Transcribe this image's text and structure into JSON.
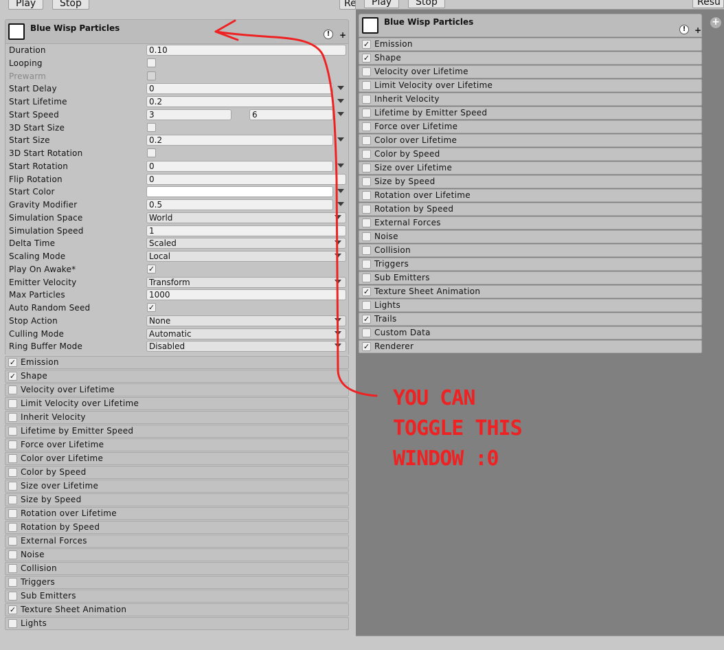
{
  "toolbar": {
    "play_label": "Play",
    "stop_label": "Stop",
    "reset_label": "Re",
    "reset_label_right": "Resu"
  },
  "component": {
    "title": "Blue Wisp Particles",
    "help_symbol": "!",
    "add_symbol": "+"
  },
  "properties": [
    {
      "label": "Duration",
      "type": "field",
      "value": "0.10"
    },
    {
      "label": "Looping",
      "type": "checkbox",
      "checked": false
    },
    {
      "label": "Prewarm",
      "type": "checkbox",
      "checked": false,
      "disabled": true
    },
    {
      "label": "Start Delay",
      "type": "field-dd",
      "value": "0"
    },
    {
      "label": "Start Lifetime",
      "type": "field-dd",
      "value": "0.2"
    },
    {
      "label": "Start Speed",
      "type": "range-dd",
      "value": "3",
      "value2": "6"
    },
    {
      "label": "3D Start Size",
      "type": "checkbox",
      "checked": false
    },
    {
      "label": "Start Size",
      "type": "field-dd",
      "value": "0.2"
    },
    {
      "label": "3D Start Rotation",
      "type": "checkbox",
      "checked": false
    },
    {
      "label": "Start Rotation",
      "type": "field-dd",
      "value": "0"
    },
    {
      "label": "Flip Rotation",
      "type": "field",
      "value": "0"
    },
    {
      "label": "Start Color",
      "type": "color-dd",
      "value": "#ffffff"
    },
    {
      "label": "Gravity Modifier",
      "type": "field-dd",
      "value": "0.5"
    },
    {
      "label": "Simulation Space",
      "type": "dropdown",
      "value": "World"
    },
    {
      "label": "Simulation Speed",
      "type": "field",
      "value": "1"
    },
    {
      "label": "Delta Time",
      "type": "dropdown",
      "value": "Scaled"
    },
    {
      "label": "Scaling Mode",
      "type": "dropdown",
      "value": "Local"
    },
    {
      "label": "Play On Awake*",
      "type": "checkbox",
      "checked": true
    },
    {
      "label": "Emitter Velocity",
      "type": "dropdown",
      "value": "Transform"
    },
    {
      "label": "Max Particles",
      "type": "field",
      "value": "1000"
    },
    {
      "label": "Auto Random Seed",
      "type": "checkbox",
      "checked": true
    },
    {
      "label": "Stop Action",
      "type": "dropdown",
      "value": "None"
    },
    {
      "label": "Culling Mode",
      "type": "dropdown",
      "value": "Automatic"
    },
    {
      "label": "Ring Buffer Mode",
      "type": "dropdown",
      "value": "Disabled"
    }
  ],
  "modules_left": [
    {
      "label": "Emission",
      "checked": true
    },
    {
      "label": "Shape",
      "checked": true
    },
    {
      "label": "Velocity over Lifetime",
      "checked": false
    },
    {
      "label": "Limit Velocity over Lifetime",
      "checked": false
    },
    {
      "label": "Inherit Velocity",
      "checked": false
    },
    {
      "label": "Lifetime by Emitter Speed",
      "checked": false
    },
    {
      "label": "Force over Lifetime",
      "checked": false
    },
    {
      "label": "Color over Lifetime",
      "checked": false
    },
    {
      "label": "Color by Speed",
      "checked": false
    },
    {
      "label": "Size over Lifetime",
      "checked": false
    },
    {
      "label": "Size by Speed",
      "checked": false
    },
    {
      "label": "Rotation over Lifetime",
      "checked": false
    },
    {
      "label": "Rotation by Speed",
      "checked": false
    },
    {
      "label": "External Forces",
      "checked": false
    },
    {
      "label": "Noise",
      "checked": false
    },
    {
      "label": "Collision",
      "checked": false
    },
    {
      "label": "Triggers",
      "checked": false
    },
    {
      "label": "Sub Emitters",
      "checked": false
    },
    {
      "label": "Texture Sheet Animation",
      "checked": true
    },
    {
      "label": "Lights",
      "checked": false
    }
  ],
  "modules_right": [
    {
      "label": "Emission",
      "checked": true
    },
    {
      "label": "Shape",
      "checked": true
    },
    {
      "label": "Velocity over Lifetime",
      "checked": false
    },
    {
      "label": "Limit Velocity over Lifetime",
      "checked": false
    },
    {
      "label": "Inherit Velocity",
      "checked": false
    },
    {
      "label": "Lifetime by Emitter Speed",
      "checked": false
    },
    {
      "label": "Force over Lifetime",
      "checked": false
    },
    {
      "label": "Color over Lifetime",
      "checked": false
    },
    {
      "label": "Color by Speed",
      "checked": false
    },
    {
      "label": "Size over Lifetime",
      "checked": false
    },
    {
      "label": "Size by Speed",
      "checked": false
    },
    {
      "label": "Rotation over Lifetime",
      "checked": false
    },
    {
      "label": "Rotation by Speed",
      "checked": false
    },
    {
      "label": "External Forces",
      "checked": false
    },
    {
      "label": "Noise",
      "checked": false
    },
    {
      "label": "Collision",
      "checked": false
    },
    {
      "label": "Triggers",
      "checked": false
    },
    {
      "label": "Sub Emitters",
      "checked": false
    },
    {
      "label": "Texture Sheet Animation",
      "checked": true
    },
    {
      "label": "Lights",
      "checked": false
    },
    {
      "label": "Trails",
      "checked": true
    },
    {
      "label": "Custom Data",
      "checked": false
    },
    {
      "label": "Renderer",
      "checked": true
    }
  ],
  "annotation": {
    "lines": [
      "YOU CAN",
      "TOGGLE THIS",
      "WINDOW :0"
    ],
    "color": "#ee2222"
  },
  "check_glyph": "✓",
  "side_add_symbol": "+"
}
